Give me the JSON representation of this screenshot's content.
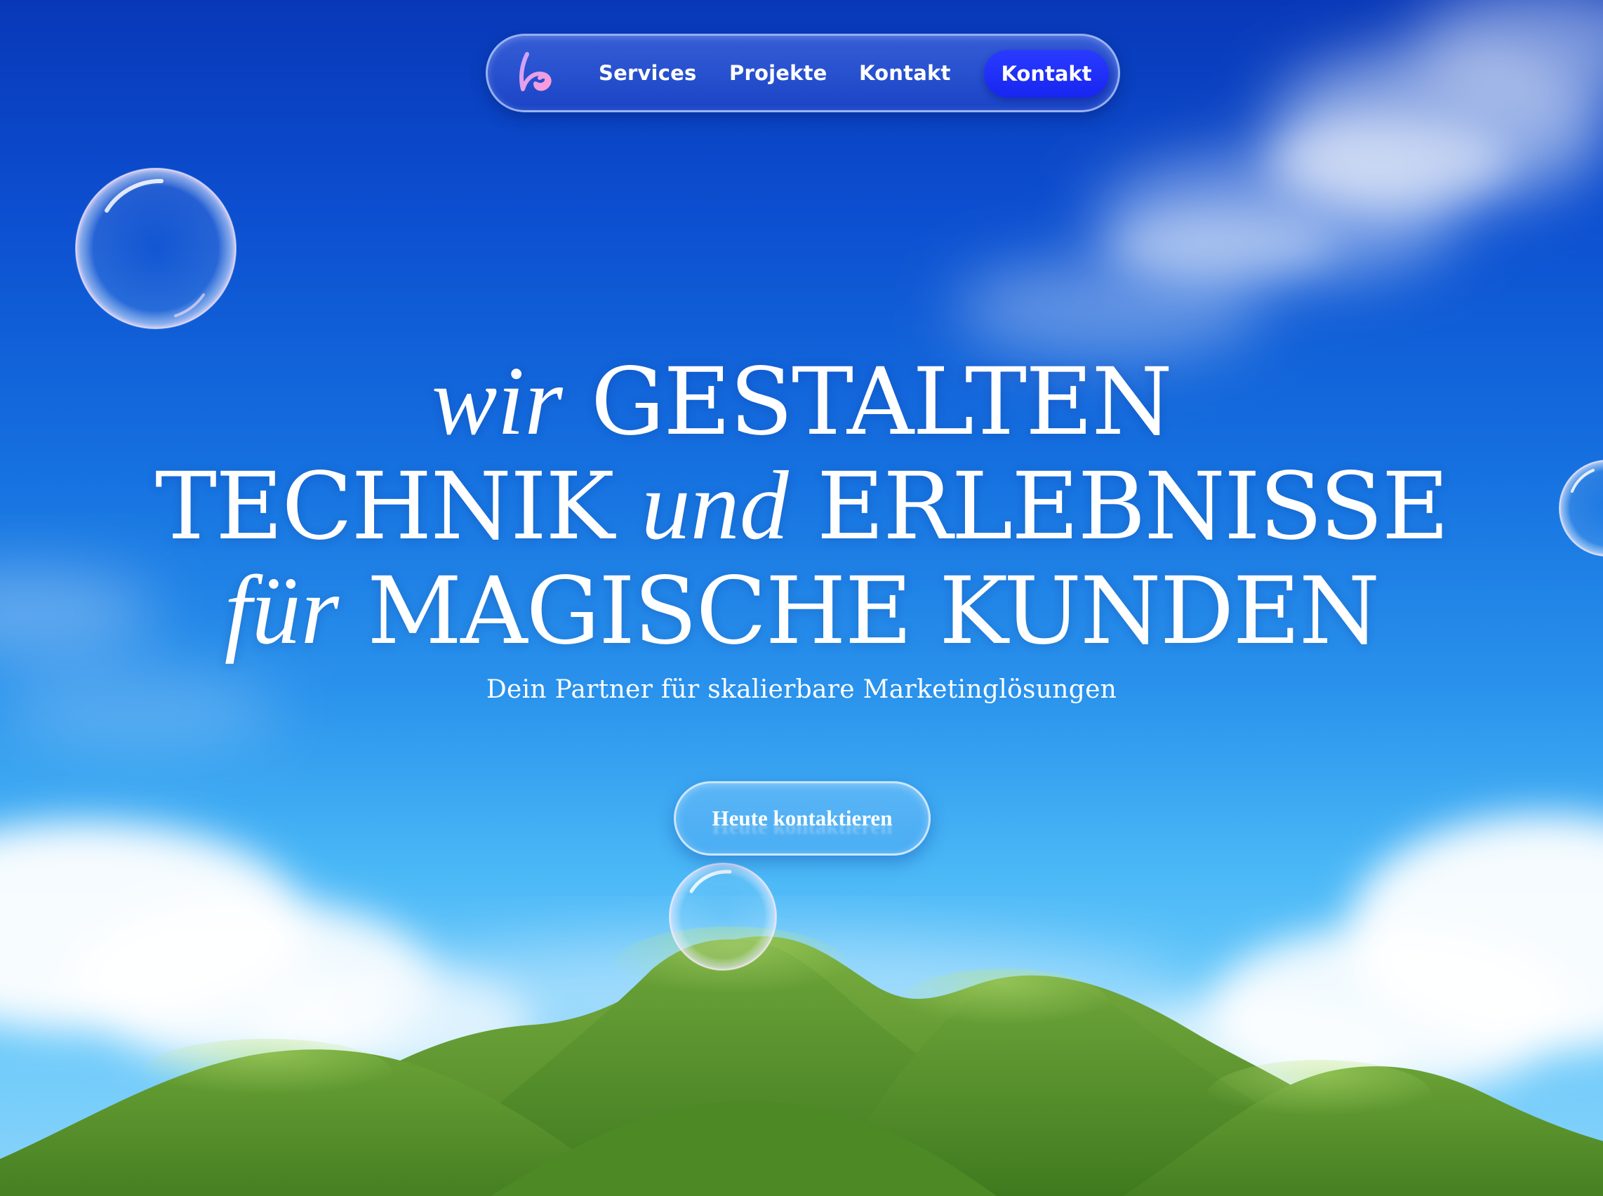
{
  "nav": {
    "logo_icon": "swirl-b-logo-icon",
    "links": [
      {
        "label": "Services"
      },
      {
        "label": "Projekte"
      },
      {
        "label": "Kontakt"
      }
    ],
    "cta_label": "Kontakt"
  },
  "hero": {
    "line1_italic": "wir",
    "line1_caps": "GESTALTEN",
    "line2_caps_a": "TECHNIK",
    "line2_italic": "und",
    "line2_caps_b": "ERLEBNISSE",
    "line3_italic": "für",
    "line3_caps": "MAGISCHE KUNDEN",
    "subline": "Dein Partner für skalierbare Marketinglösungen",
    "cta_label": "Heute kontaktieren"
  },
  "colors": {
    "sky_top": "#0838b8",
    "sky_bottom": "#8ad4fb",
    "nav_cta": "#1726f0",
    "hills": "#5f9a2c",
    "text": "#ffffff"
  }
}
